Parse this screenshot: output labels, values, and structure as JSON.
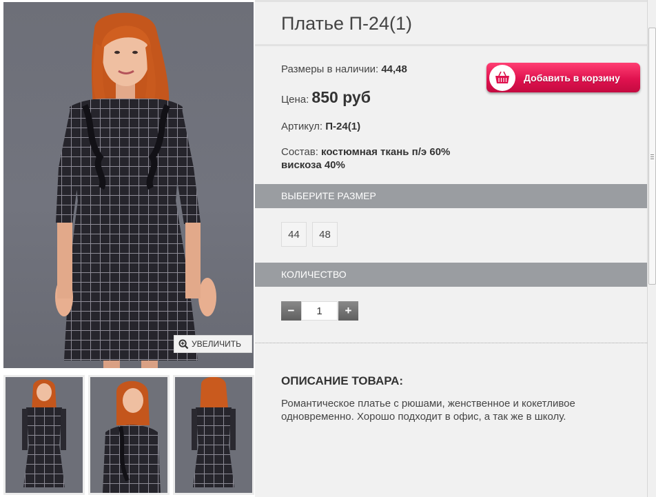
{
  "product": {
    "title": "Платье П-24(1)",
    "sizes_label": "Размеры в наличии: ",
    "sizes_value": "44,48",
    "price_label": "Цена: ",
    "price_value": "850 руб",
    "article_label": "Артикул: ",
    "article_value": "П-24(1)",
    "composition_label": "Состав: ",
    "composition_value_line1": "костюмная ткань п/э 60%",
    "composition_value_line2": "вискоза 40%"
  },
  "cart_button": {
    "label": "Добавить в корзину",
    "icon": "basket-icon",
    "color": "#e0124f"
  },
  "gallery": {
    "zoom_label": "УВЕЛИЧИТЬ",
    "zoom_icon": "magnifier-plus-icon",
    "thumbnails": [
      "front",
      "three-quarter",
      "back"
    ]
  },
  "size_section": {
    "header": "ВЫБЕРИТЕ РАЗМЕР",
    "options": [
      "44",
      "48"
    ]
  },
  "quantity_section": {
    "header": "КОЛИЧЕСТВО",
    "minus": "−",
    "plus": "+",
    "value": "1"
  },
  "description": {
    "heading": "ОПИСАНИЕ ТОВАРА:",
    "text": "Романтическое платье с рюшами, женственное и кокетливое одновременно. Хорошо подходит в офис, а так же в школу."
  },
  "colors": {
    "panel_bg": "#f1f1f1",
    "section_bar": "#9a9da1",
    "accent": "#e0124f"
  }
}
